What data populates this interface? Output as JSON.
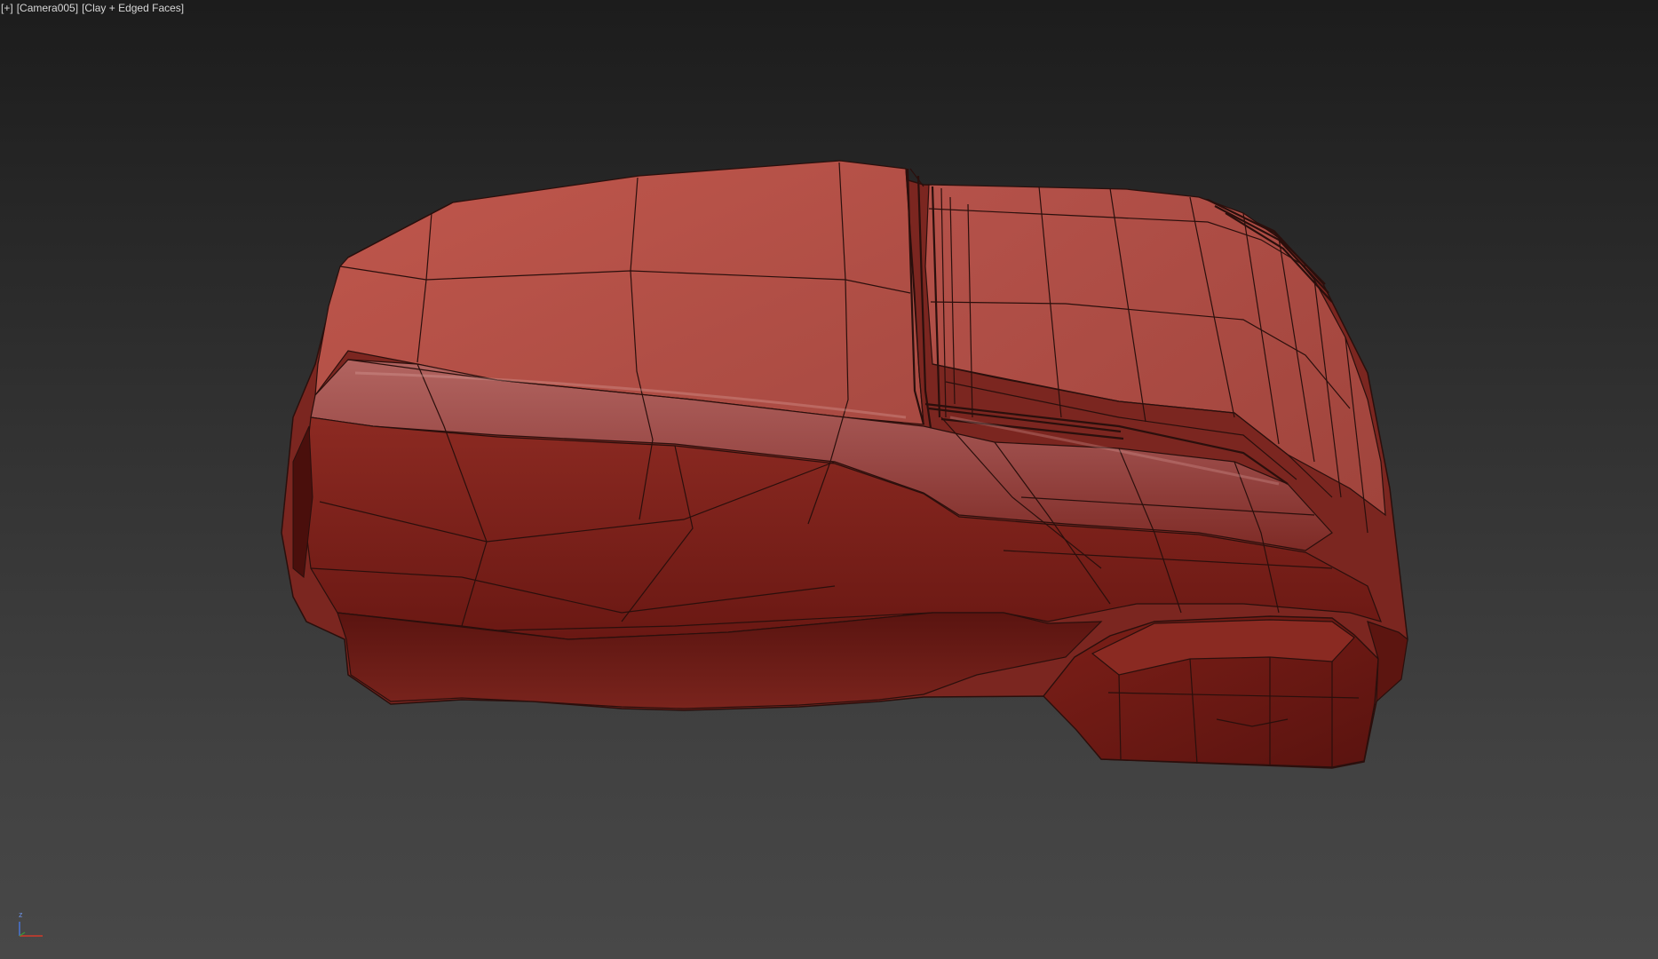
{
  "viewport": {
    "label_plus": "[+]",
    "label_camera": "[Camera005]",
    "label_shading": "[Clay + Edged Faces]",
    "background_colors": [
      "#1c1c1c",
      "#484848"
    ]
  },
  "model": {
    "clay_color": "#a94a42",
    "edge_color": "#2a0f0c"
  },
  "axis_gizmo": {
    "z_label": "z",
    "x_color": "#d23a2a",
    "z_color": "#4a78e0"
  }
}
